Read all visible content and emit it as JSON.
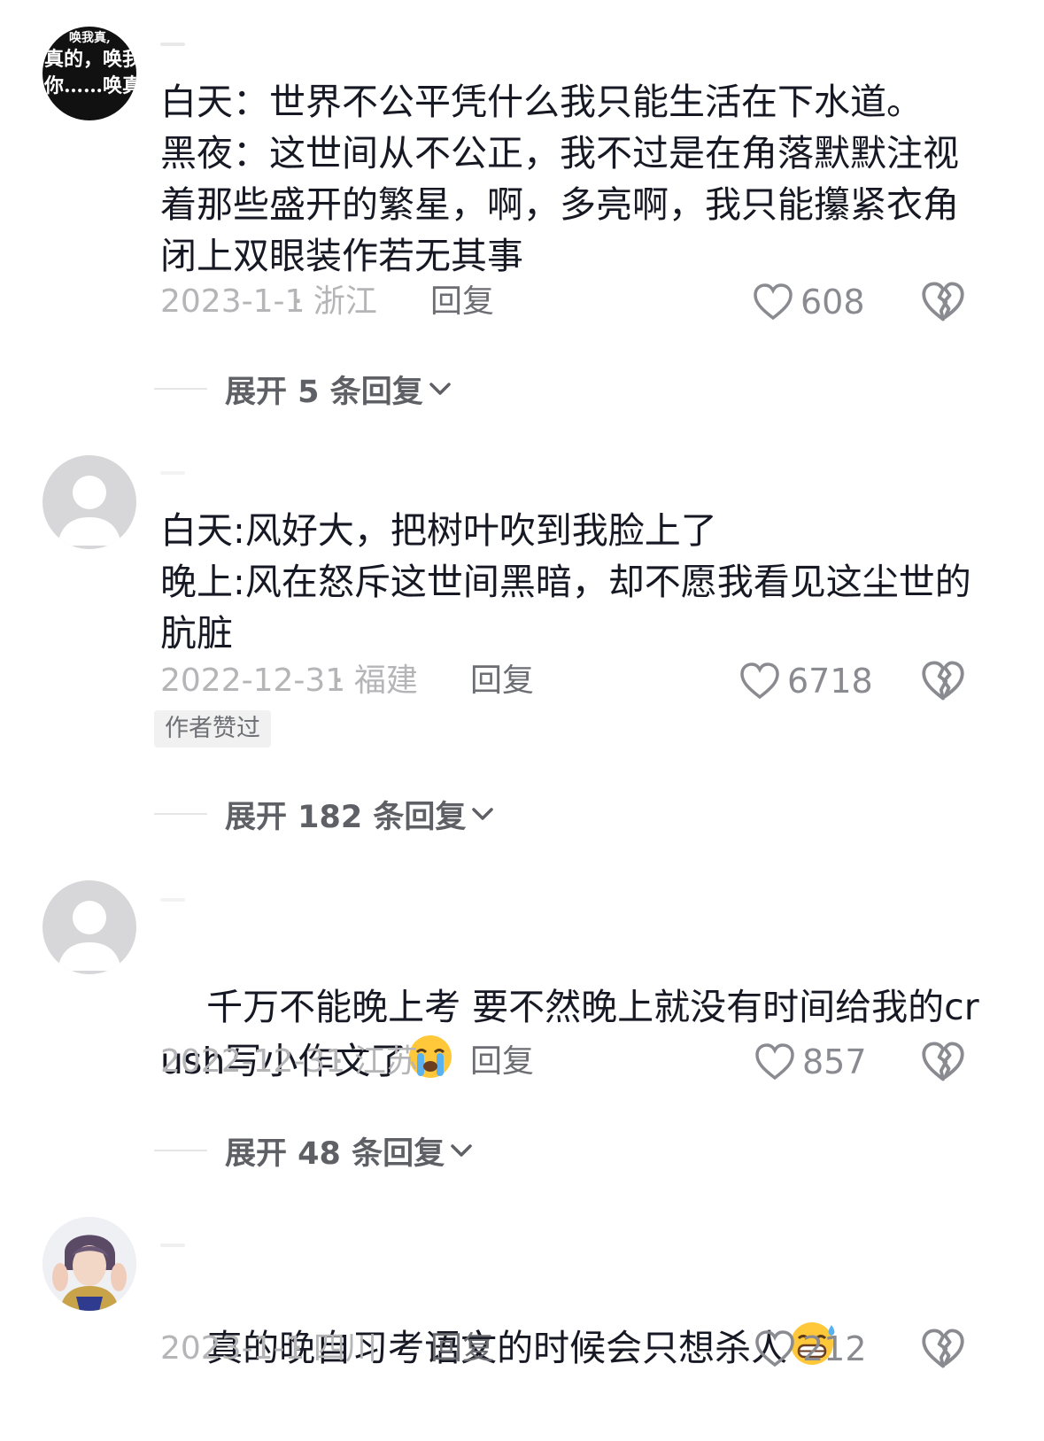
{
  "comments": [
    {
      "avatar_text": [
        "唤我真,",
        "真的，唤我",
        "你……唤真是"
      ],
      "text": "白天：世界不公平凭什么我只能生活在下水道。　　　　　黑夜：这世间从不公正，我不过是在角落默默注视着那些盛开的繁星，啊，多亮啊，我只能攥紧衣角闭上双眼装作若无其事",
      "date": "2023-1-1",
      "location": "· 浙江",
      "reply_label": "回复",
      "likes": "608",
      "expand_label": "展开 5 条回复"
    },
    {
      "text": "白天:风好大，把树叶吹到我脸上了\n晚上:风在怒斥这世间黑暗，却不愿我看见这尘世的肮脏",
      "date": "2022-12-31",
      "location": "· 福建",
      "reply_label": "回复",
      "likes": "6718",
      "badge": "作者赞过",
      "expand_label": "展开 182 条回复"
    },
    {
      "text": "千万不能晚上考 要不然晚上就没有时间给我的crush写小作文了",
      "emoji": "crying-emoji",
      "date": "2022-12-31",
      "location": "· 江苏",
      "reply_label": "回复",
      "likes": "857",
      "expand_label": "展开 48 条回复"
    },
    {
      "text": "真的晚自习考语文的时候会只想杀人",
      "emoji": "grinning-sweat-emoji",
      "date": "2023-1-1",
      "location": "· 四川",
      "reply_label": "回复",
      "likes": "212"
    }
  ],
  "colors": {
    "text": "#161823",
    "meta": "#b5b5b8",
    "reply": "#6d6e73",
    "expand": "#5f6066"
  }
}
